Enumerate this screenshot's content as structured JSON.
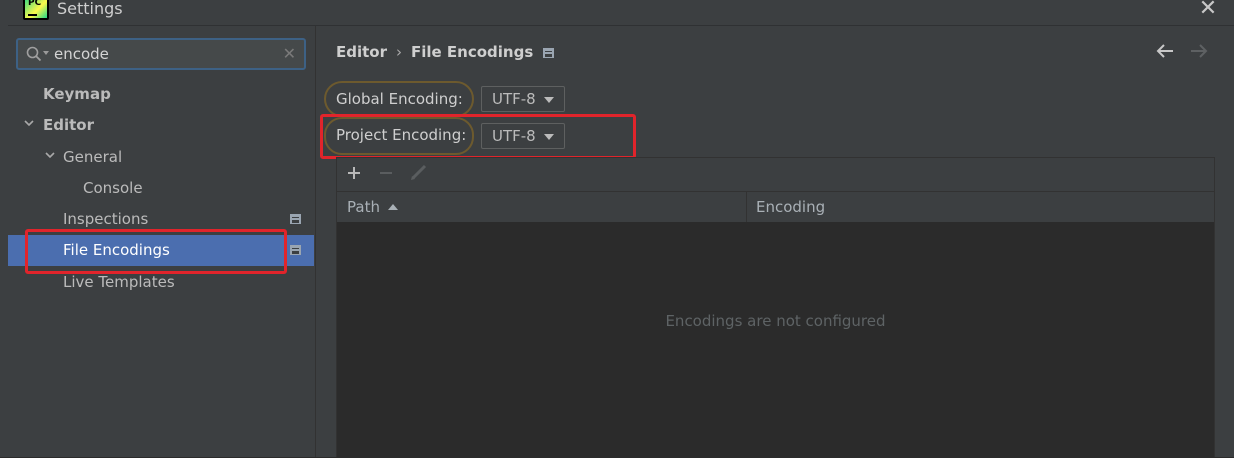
{
  "window": {
    "title": "Settings",
    "logo_text": "PC"
  },
  "sidebar": {
    "search": {
      "value": "encode",
      "placeholder": ""
    },
    "items": [
      {
        "label": "Keymap",
        "bold": true
      },
      {
        "label": "Editor",
        "bold": true,
        "expanded": true
      },
      {
        "label": "General",
        "expanded": true
      },
      {
        "label": "Console"
      },
      {
        "label": "Inspections",
        "project_scoped": true
      },
      {
        "label": "File Encodings",
        "project_scoped": true,
        "selected": true
      },
      {
        "label": "Live Templates"
      }
    ]
  },
  "content": {
    "breadcrumb": {
      "parent": "Editor",
      "separator": "›",
      "current": "File Encodings"
    },
    "global_encoding": {
      "label": "Global Encoding:",
      "value": "UTF-8"
    },
    "project_encoding": {
      "label": "Project Encoding:",
      "value": "UTF-8"
    },
    "table": {
      "columns": [
        "Path",
        "Encoding"
      ],
      "sorted_column": "Path",
      "sort_direction": "ascending",
      "empty_text": "Encodings are not configured"
    }
  },
  "colors": {
    "background": "#2b2b2b",
    "panel": "#3c3f41",
    "selection": "#4b6eaf",
    "annotation_red": "#e1242b",
    "annotation_oval": "#6d5a2e"
  }
}
